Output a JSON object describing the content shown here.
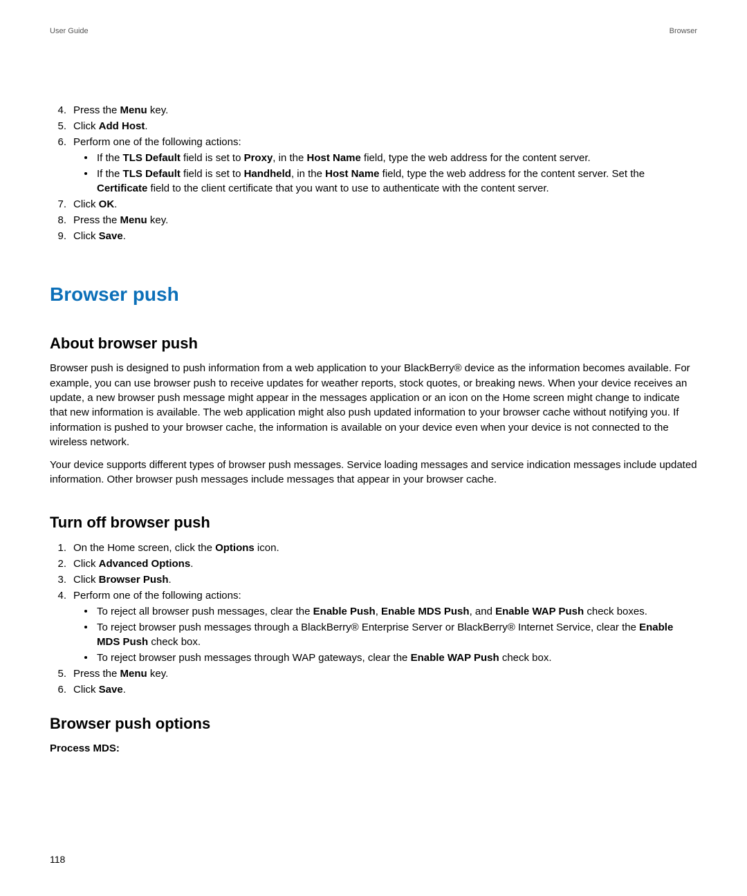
{
  "header": {
    "left": "User Guide",
    "right": "Browser"
  },
  "stepsA": {
    "s4": {
      "num": "4.",
      "a": "Press the ",
      "b": "Menu",
      "c": " key."
    },
    "s5": {
      "num": "5.",
      "a": "Click ",
      "b": "Add Host",
      "c": "."
    },
    "s6": {
      "num": "6.",
      "text": "Perform one of the following actions:",
      "bullets": [
        {
          "p": "If the ",
          "b1": "TLS Default",
          "p2": " field is set to ",
          "b2": "Proxy",
          "p3": ", in the ",
          "b3": "Host Name",
          "p4": " field, type the web address for the content server."
        },
        {
          "p": "If the ",
          "b1": "TLS Default",
          "p2": " field is set to ",
          "b2": "Handheld",
          "p3": ", in the ",
          "b3": "Host Name",
          "p4": " field, type the web address for the content server. Set the ",
          "b4": "Certificate",
          "p5": " field to the client certificate that you want to use to authenticate with the content server."
        }
      ]
    },
    "s7": {
      "num": "7.",
      "a": "Click ",
      "b": "OK",
      "c": "."
    },
    "s8": {
      "num": "8.",
      "a": "Press the ",
      "b": "Menu",
      "c": " key."
    },
    "s9": {
      "num": "9.",
      "a": "Click ",
      "b": "Save",
      "c": "."
    }
  },
  "heading1": "Browser push",
  "about": {
    "title": "About browser push",
    "p1": "Browser push is designed to push information from a web application to your BlackBerry® device as the information becomes available. For example, you can use browser push to receive updates for weather reports, stock quotes, or breaking news. When your device receives an update, a new browser push message might appear in the messages application or an icon on the Home screen might change to indicate that new information is available. The web application might also push updated information to your browser cache without notifying you. If information is pushed to your browser cache, the information is available on your device even when your device is not connected to the wireless network.",
    "p2": "Your device supports different types of browser push messages. Service loading messages and service indication messages include updated information. Other browser push messages include messages that appear in your browser cache."
  },
  "turnoff": {
    "title": "Turn off browser push",
    "s1": {
      "num": "1.",
      "a": "On the Home screen, click the ",
      "b": "Options",
      "c": " icon."
    },
    "s2": {
      "num": "2.",
      "a": "Click ",
      "b": "Advanced Options",
      "c": "."
    },
    "s3": {
      "num": "3.",
      "a": "Click ",
      "b": "Browser Push",
      "c": "."
    },
    "s4": {
      "num": "4.",
      "text": "Perform one of the following actions:",
      "b1": {
        "p1": "To reject all browser push messages, clear the ",
        "b1": "Enable Push",
        "p2": ", ",
        "b2": "Enable MDS Push",
        "p3": ", and ",
        "b3": "Enable WAP Push",
        "p4": " check boxes."
      },
      "b2": {
        "p1": "To reject browser push messages through a BlackBerry® Enterprise Server or BlackBerry® Internet Service, clear the ",
        "b1": "Enable MDS Push",
        "p2": " check box."
      },
      "b3": {
        "p1": "To reject browser push messages through WAP gateways, clear the ",
        "b1": "Enable WAP Push",
        "p2": " check box."
      }
    },
    "s5": {
      "num": "5.",
      "a": "Press the ",
      "b": "Menu",
      "c": " key."
    },
    "s6": {
      "num": "6.",
      "a": "Click ",
      "b": "Save",
      "c": "."
    }
  },
  "options": {
    "title": "Browser push options",
    "opt1": "Process MDS:"
  },
  "pageNumber": "118"
}
